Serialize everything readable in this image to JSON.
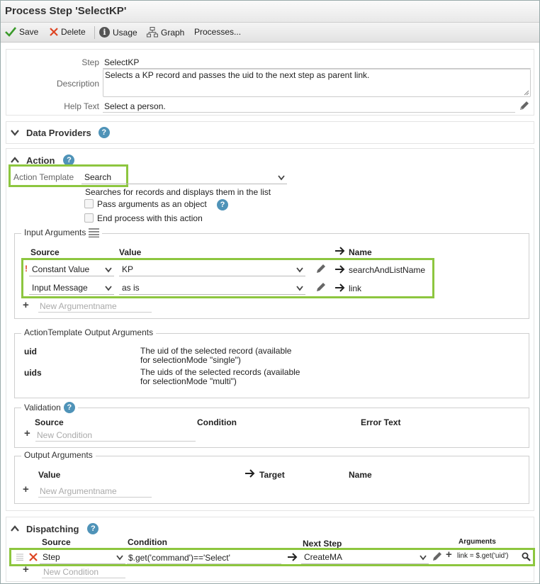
{
  "title": "Process Step 'SelectKP'",
  "toolbar": {
    "save": "Save",
    "delete": "Delete",
    "usage": "Usage",
    "graph": "Graph",
    "processes": "Processes..."
  },
  "step": {
    "step_label": "Step",
    "step_value": "SelectKP",
    "description_label": "Description",
    "description_value": "Selects a KP record and passes the uid to the next step as parent link.",
    "help_label": "Help Text",
    "help_value": "Select a person."
  },
  "data_providers": {
    "title": "Data Providers"
  },
  "action": {
    "title": "Action",
    "template_label": "Action Template",
    "template_value": "Search",
    "template_desc": "Searches for records and displays them in the list",
    "opt_pass_args": "Pass arguments as an object",
    "opt_end_process": "End process with this action",
    "input_args": {
      "legend": "Input Arguments",
      "col_source": "Source",
      "col_value": "Value",
      "col_name": "Name",
      "rows": [
        {
          "warn": "!",
          "source": "Constant Value",
          "value": "KP",
          "name": "searchAndListName"
        },
        {
          "warn": "",
          "source": "Input Message",
          "value": "as is",
          "name": "link"
        }
      ],
      "new_placeholder": "New Argumentname"
    },
    "output_template": {
      "legend": "ActionTemplate Output Arguments",
      "rows": [
        {
          "name": "uid",
          "desc1": "The uid of the selected record (available",
          "desc2": "for selectionMode \"single\")"
        },
        {
          "name": "uids",
          "desc1": "The uids of the selected records (available",
          "desc2": "for selectionMode \"multi\")"
        }
      ]
    },
    "validation": {
      "legend": "Validation",
      "col_source": "Source",
      "col_condition": "Condition",
      "col_error": "Error Text",
      "new_placeholder": "New Condition"
    },
    "output_args": {
      "legend": "Output Arguments",
      "col_value": "Value",
      "col_target": "Target",
      "col_name": "Name",
      "new_placeholder": "New Argumentname"
    }
  },
  "dispatching": {
    "title": "Dispatching",
    "col_source": "Source",
    "col_condition": "Condition",
    "col_next": "Next Step",
    "col_args": "Arguments",
    "row": {
      "source": "Step",
      "condition": "$.get('command')=='Select'",
      "next": "CreateMA",
      "args": "link = $.get('uid')"
    },
    "new_placeholder": "New Condition"
  },
  "colors": {
    "accent_green": "#8dc63f",
    "help_blue": "#4f93b8",
    "delete_red": "#d42"
  }
}
